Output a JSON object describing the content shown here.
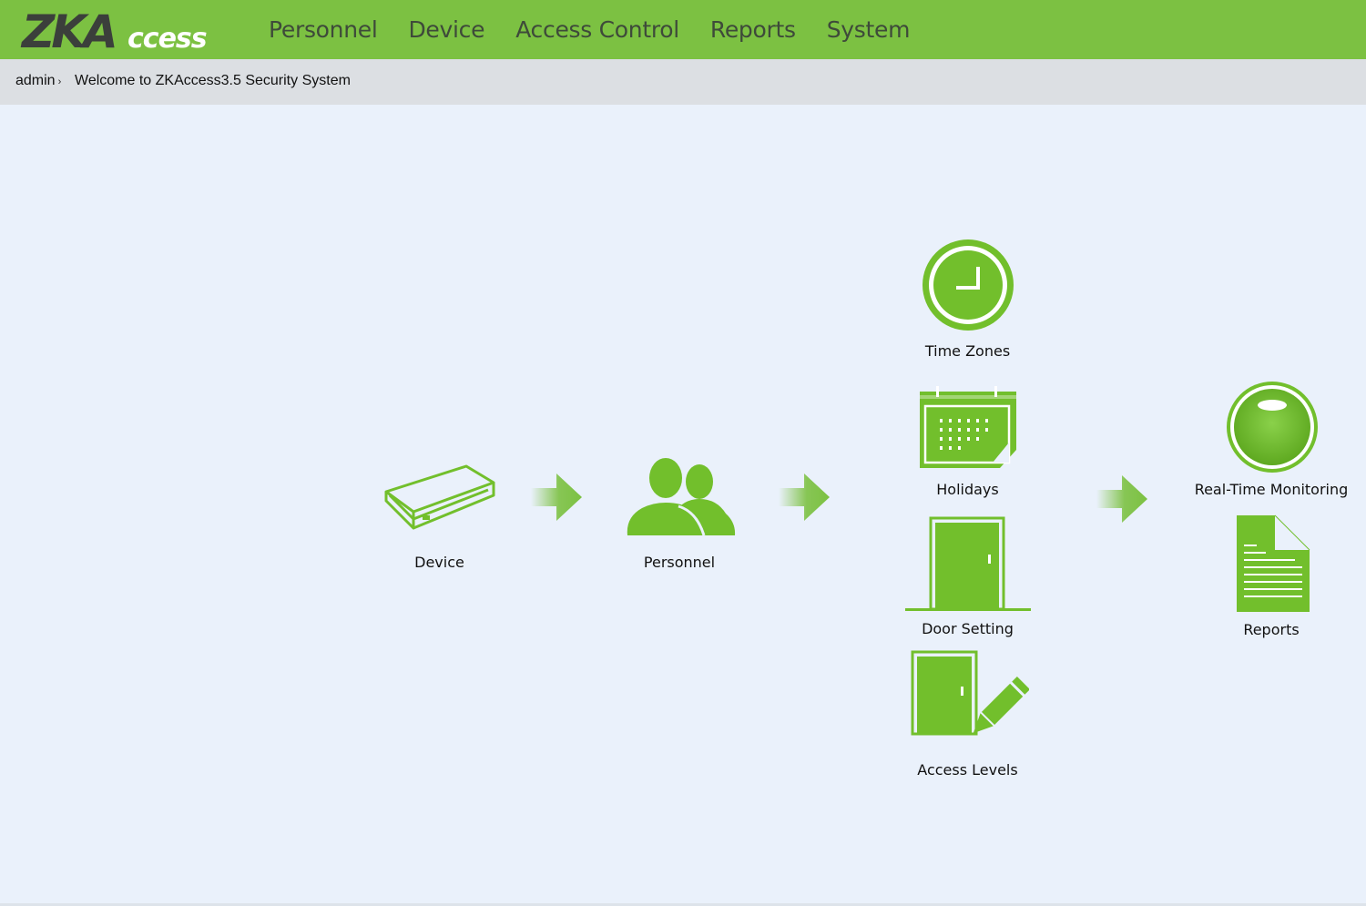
{
  "app": {
    "logo_text": "ZKAccess",
    "brand_color": "#7cc142",
    "icon_color": "#72bf2c"
  },
  "nav": {
    "items": [
      {
        "label": "Personnel"
      },
      {
        "label": "Device"
      },
      {
        "label": "Access Control"
      },
      {
        "label": "Reports"
      },
      {
        "label": "System"
      }
    ]
  },
  "infobar": {
    "user": "admin",
    "welcome": "Welcome to ZKAccess3.5 Security System"
  },
  "workflow": {
    "device": {
      "label": "Device",
      "icon": "device-icon"
    },
    "personnel": {
      "label": "Personnel",
      "icon": "users-icon"
    },
    "time_zones": {
      "label": "Time Zones",
      "icon": "clock-icon"
    },
    "holidays": {
      "label": "Holidays",
      "icon": "calendar-icon"
    },
    "door_setting": {
      "label": "Door Setting",
      "icon": "door-icon"
    },
    "access_levels": {
      "label": "Access Levels",
      "icon": "door-pencil-icon"
    },
    "real_time_monitoring": {
      "label": "Real-Time Monitoring",
      "icon": "monitor-orb-icon"
    },
    "reports": {
      "label": "Reports",
      "icon": "document-icon"
    }
  }
}
